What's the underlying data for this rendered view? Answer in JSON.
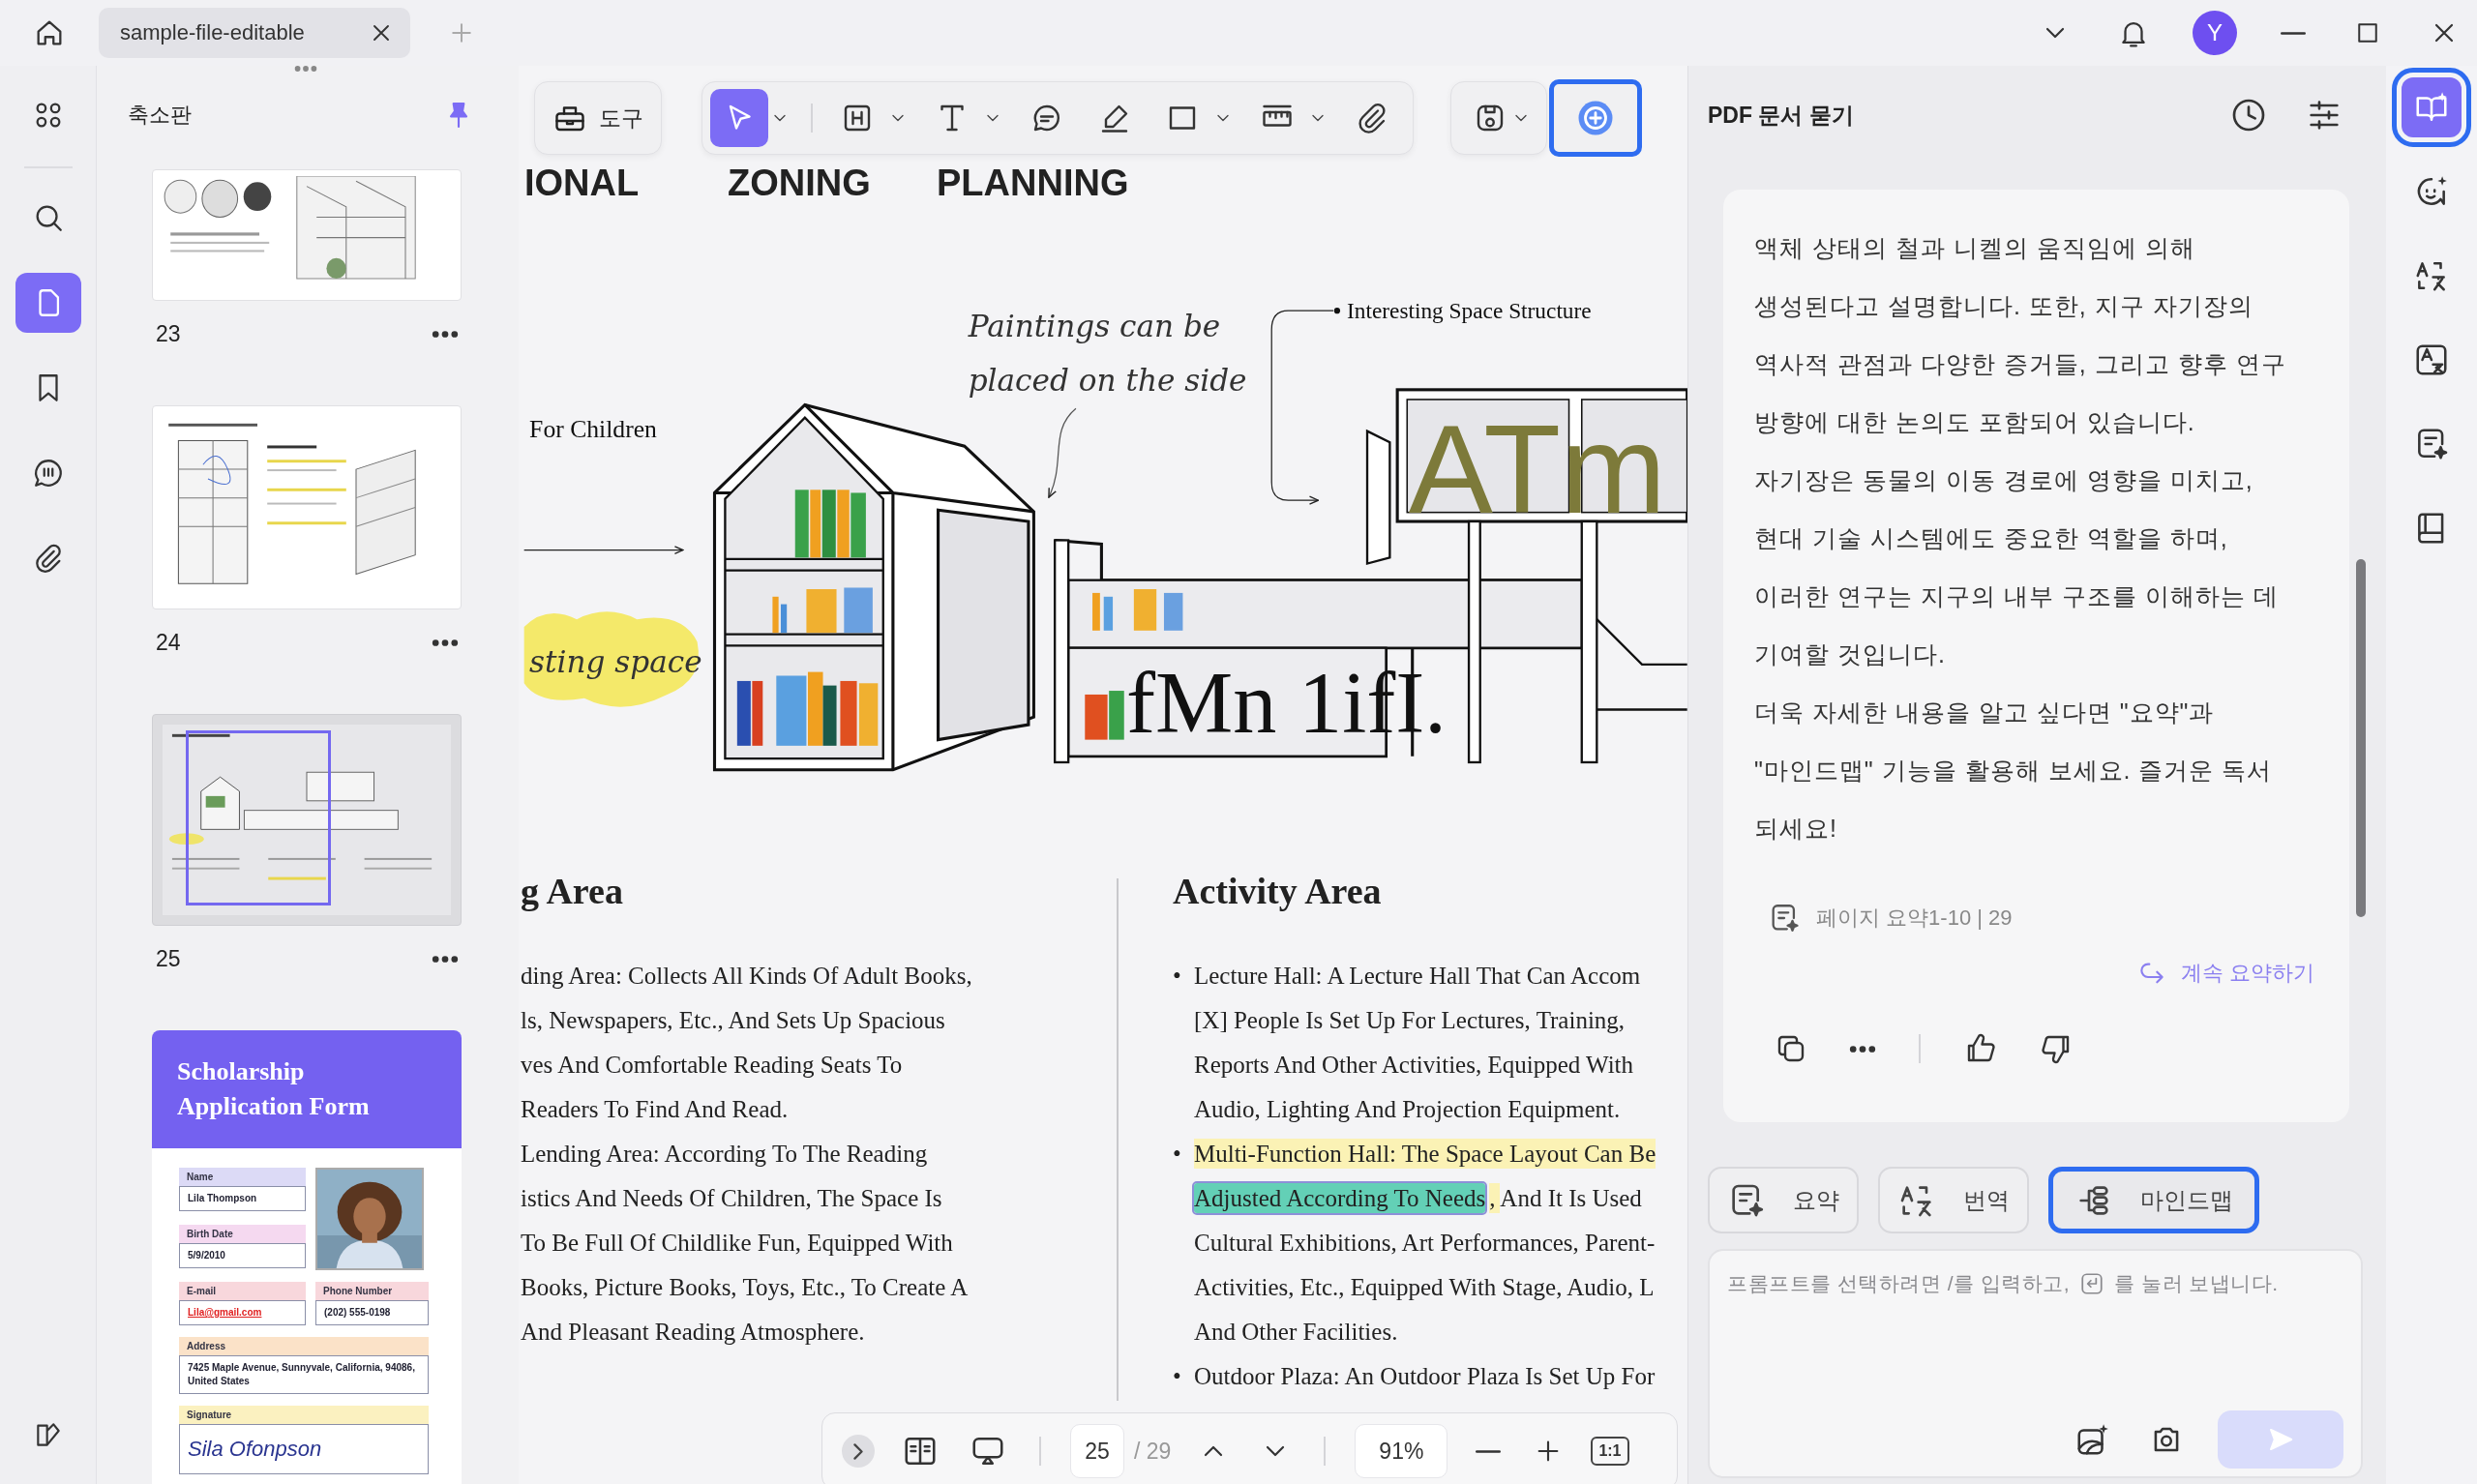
{
  "tab_bar": {
    "tab": {
      "title": "sample-file-editable",
      "selected": true
    },
    "avatar": "Y"
  },
  "left_rail": {
    "items": [
      {
        "selected": false
      },
      {
        "selected": false
      },
      {
        "selected": true
      },
      {
        "selected": false
      },
      {
        "selected": false
      },
      {
        "selected": false
      }
    ]
  },
  "thumbnails": {
    "title": "축소판",
    "pinned": true,
    "pages": [
      {
        "number": "23",
        "selected": false
      },
      {
        "number": "24",
        "selected": false
      },
      {
        "number": "25",
        "selected": true
      }
    ],
    "form_page": {
      "title": "Scholarship Application Form",
      "fields": [
        {
          "label": "Name",
          "value": "Lila Thompson",
          "color": "#dcdaf6",
          "kind": "text"
        },
        {
          "label": "Birth Date",
          "value": "5/9/2010",
          "color": "#f5d9f0",
          "kind": "text"
        },
        {
          "label": "E-mail",
          "value": "Lila@gmail.com",
          "color": "#f8d7dc",
          "kind": "link"
        },
        {
          "label": "Phone Number",
          "value": "(202) 555-0198",
          "color": "#f8d7dc",
          "kind": "text"
        },
        {
          "label": "Address",
          "value": "7425 Maple Avenue, Sunnyvale, California, 94086, United States",
          "color": "#fbe2c8",
          "kind": "wide"
        },
        {
          "label": "Signature",
          "value": "Sila Ofonpson",
          "color": "#fbf1c0",
          "kind": "signature"
        }
      ]
    }
  },
  "toolbar": {
    "tools_label": "도구",
    "tools": [
      {
        "selected": true,
        "menu": true
      },
      {
        "selected": false,
        "menu": true
      },
      {
        "selected": false,
        "menu": true
      },
      {
        "selected": false,
        "menu": false
      },
      {
        "selected": false,
        "menu": false
      },
      {
        "selected": false,
        "menu": true
      },
      {
        "selected": false,
        "menu": true
      },
      {
        "selected": false,
        "menu": false
      }
    ],
    "save_menu": true,
    "ai_selected": true
  },
  "document": {
    "section_labels": [
      "IONAL",
      "ZONING",
      "PLANNING"
    ],
    "drawing": {
      "left_label": "For Children",
      "marker_label": "sting space",
      "note_lines": [
        "Paintings can be",
        "placed on the side"
      ],
      "callout": "Interesting Space Structure",
      "overlay_large": "ATm",
      "overlay_small": "fMn 1ifI."
    },
    "left_column": {
      "heading": "g Area",
      "items": [
        [
          "ding Area: Collects All Kinds Of Adult Books,",
          "ls, Newspapers, Etc., And Sets Up Spacious",
          "ves And Comfortable Reading Seats To",
          "Readers To Find And Read."
        ],
        [
          "Lending Area: According To The Reading",
          "istics And Needs Of Children, The Space Is",
          "To Be Full Of Childlike Fun, Equipped With",
          "Books, Picture Books, Toys, Etc., To Create A",
          "And Pleasant Reading Atmosphere."
        ]
      ]
    },
    "right_column": {
      "heading": "Activity Area",
      "bullets": [
        {
          "marker": "•",
          "lines": [
            [
              {
                "text": "Lecture Hall: A Lecture Hall That Can Accom"
              }
            ],
            [
              {
                "text": "[X] People Is Set Up For Lectures, Training,"
              }
            ],
            [
              {
                "text": "Reports And Other Activities, Equipped With"
              }
            ],
            [
              {
                "text": "Audio, Lighting And Projection Equipment."
              }
            ]
          ]
        },
        {
          "marker": "•",
          "lines": [
            [
              {
                "text": "Multi-Function Hall: The Space Layout Can Be",
                "color": "#fbf2b5"
              }
            ],
            [
              {
                "text": "Adjusted According To Needs",
                "color": "#63d0b6",
                "selected": true
              },
              {
                "text": ", ",
                "color": "#fbf2b5",
                "selected": false
              },
              {
                "text": "And It Is Used",
                "selected": false
              }
            ],
            [
              {
                "text": "Cultural Exhibitions, Art Performances, Parent-"
              }
            ],
            [
              {
                "text": "Activities, Etc., Equipped With Stage, Audio, L"
              }
            ],
            [
              {
                "text": "And Other Facilities."
              }
            ]
          ]
        },
        {
          "marker": "•",
          "lines": [
            [
              {
                "text": "Outdoor Plaza: An Outdoor Plaza Is Set Up For"
              }
            ]
          ]
        }
      ]
    }
  },
  "page_bar": {
    "page": "25",
    "total": "/ 29",
    "zoom": "91%",
    "fit": "1:1"
  },
  "assistant": {
    "title": "PDF 문서 묻기",
    "paragraphs": [
      [
        "액체 상태의 철과 니켈의 움직임에 의해",
        "생성된다고 설명합니다. 또한, 지구 자기장의",
        "역사적 관점과 다양한 증거들, 그리고 향후 연구",
        "방향에 대한 논의도 포함되어 있습니다."
      ],
      [
        "자기장은 동물의 이동 경로에 영향을 미치고,",
        "현대 기술 시스템에도 중요한 역할을 하며,",
        "이러한 연구는 지구의 내부 구조를 이해하는 데",
        "기여할 것입니다."
      ],
      [
        "더욱 자세한 내용을 알고 싶다면 \"요약\"과",
        "\"마인드맵\" 기능을 활용해 보세요. 즐거운 독서",
        "되세요!"
      ]
    ],
    "source": "페이지 요약1-10 | 29",
    "continue_link": "계속 요약하기",
    "actions": [
      {
        "label": "요약",
        "selected": false
      },
      {
        "label": "번역",
        "selected": false
      },
      {
        "label": "마인드맵",
        "selected": true
      }
    ],
    "prompt": {
      "hint_start": "프롬프트를 선택하려면 /를 입력하고,",
      "hint_end": "를 눌러 보냅니다."
    },
    "send_enabled": false
  },
  "right_rail": {
    "items": [
      {
        "selected": true
      },
      {
        "selected": false
      },
      {
        "selected": false
      },
      {
        "selected": false
      },
      {
        "selected": false
      },
      {
        "selected": false
      }
    ]
  }
}
